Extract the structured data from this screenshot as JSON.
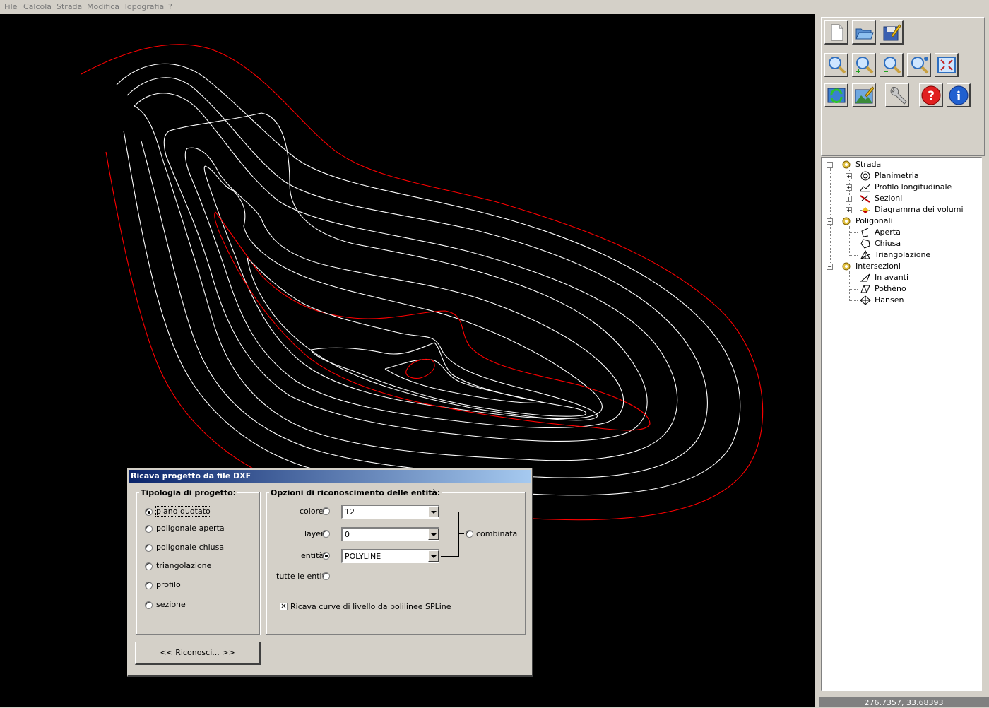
{
  "menu": [
    "File",
    "Calcola",
    "Strada",
    "Modifica",
    "Topografia",
    "?"
  ],
  "toolbar": {
    "icons": [
      "new-file-icon",
      "open-folder-icon",
      "save-icon",
      "zoom-window-icon",
      "zoom-in-icon",
      "zoom-out-icon",
      "zoom-realtime-icon",
      "zoom-extents-icon",
      "refresh-icon",
      "edit-image-icon",
      "settings-wrench-icon",
      "help-icon",
      "info-icon"
    ]
  },
  "tree": {
    "strada": "Strada",
    "planimetria": "Planimetria",
    "profilo": "Profilo longitudinale",
    "sezioni": "Sezioni",
    "diagramma": "Diagramma dei volumi",
    "poligonali": "Poligonali",
    "aperta": "Aperta",
    "chiusa": "Chiusa",
    "triangolazione": "Triangolazione",
    "intersezioni": "Intersezioni",
    "in_avanti": "In avanti",
    "pothenot": "Pothèno",
    "hansen": "Hansen"
  },
  "status": {
    "coords": "276.7357,  33.68393"
  },
  "dialog": {
    "title": "Ricava progetto da file DXF",
    "tipologia": {
      "label": "Tipologia di progetto:",
      "options": [
        "piano quotato",
        "poligonale aperta",
        "poligonale chiusa",
        "triangolazione",
        "profilo",
        "sezione"
      ],
      "selected": "piano quotato"
    },
    "opzioni": {
      "label": "Opzioni di riconoscimento delle entità:",
      "colore_label": "colore",
      "colore_value": "12",
      "layer_label": "layer",
      "layer_value": "0",
      "entita_label": "entità",
      "entita_value": "POLYLINE",
      "tutte_label": "tutte le entità",
      "combinata_label": "combinata",
      "checkbox_label": "Ricava curve di livello da polilinee SPLine",
      "checkbox_checked": true
    },
    "button_label": "<<  Riconosci...  >>"
  },
  "colors": {
    "contour_white": "#ffffff",
    "contour_red": "#ff0000",
    "canvas_bg": "#000000",
    "title_start": "#0a246a",
    "title_end": "#a6caf0"
  }
}
